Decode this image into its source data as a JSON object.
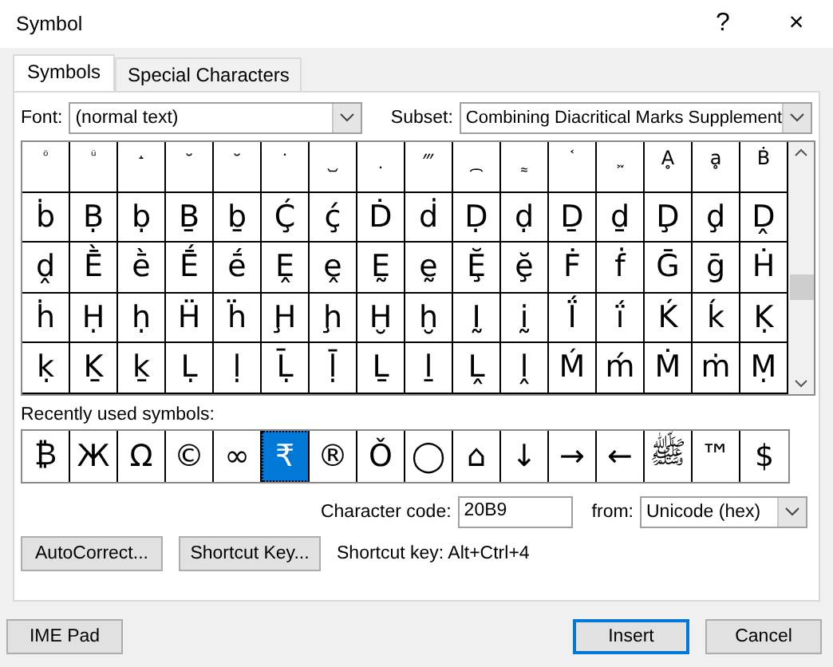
{
  "window": {
    "title": "Symbol",
    "help": "?",
    "close": "×"
  },
  "tabs": [
    {
      "label": "Symbols",
      "selected": true
    },
    {
      "label": "Special Characters",
      "selected": false
    }
  ],
  "font": {
    "label": "Font:",
    "value": "(normal text)"
  },
  "subset": {
    "label": "Subset:",
    "value": "Combining Diacritical Marks Supplement"
  },
  "symbol_grid": [
    [
      "ᷳ",
      "ᷴ",
      "᷵",
      "᷶",
      "᷷",
      "᷸",
      "᷹",
      "᷺",
      "᷻",
      "᷼",
      "᷽",
      "᷾",
      "᷿",
      "Ḁ",
      "ḁ",
      "Ḃ"
    ],
    [
      "ḃ",
      "Ḅ",
      "ḅ",
      "Ḇ",
      "ḇ",
      "Ḉ",
      "ḉ",
      "Ḋ",
      "ḋ",
      "Ḍ",
      "ḍ",
      "Ḏ",
      "ḏ",
      "Ḑ",
      "ḑ",
      "Ḓ"
    ],
    [
      "ḓ",
      "Ḕ",
      "ḕ",
      "Ḗ",
      "ḗ",
      "Ḙ",
      "ḙ",
      "Ḛ",
      "ḛ",
      "Ḝ",
      "ḝ",
      "Ḟ",
      "ḟ",
      "Ḡ",
      "ḡ",
      "Ḣ"
    ],
    [
      "ḣ",
      "Ḥ",
      "ḥ",
      "Ḧ",
      "ḧ",
      "Ḩ",
      "ḩ",
      "Ḫ",
      "ḫ",
      "Ḭ",
      "ḭ",
      "Ḯ",
      "ḯ",
      "Ḱ",
      "ḱ",
      "Ḳ"
    ],
    [
      "ḳ",
      "Ḵ",
      "ḵ",
      "Ḷ",
      "ḷ",
      "Ḹ",
      "ḹ",
      "Ḻ",
      "ḻ",
      "Ḽ",
      "ḽ",
      "Ḿ",
      "ḿ",
      "Ṁ",
      "ṁ",
      "Ṃ"
    ]
  ],
  "recent": {
    "label": "Recently used symbols:",
    "symbols": [
      {
        "char": "₿",
        "selected": false
      },
      {
        "char": "Ж",
        "selected": false
      },
      {
        "char": "Ω",
        "selected": false
      },
      {
        "char": "©",
        "selected": false
      },
      {
        "char": "∞",
        "selected": false
      },
      {
        "char": "₹",
        "selected": true
      },
      {
        "char": "®",
        "selected": false
      },
      {
        "char": "Ǒ",
        "selected": false
      },
      {
        "char": "◯",
        "selected": false
      },
      {
        "char": "⌂",
        "selected": false
      },
      {
        "char": "↓",
        "selected": false
      },
      {
        "char": "→",
        "selected": false
      },
      {
        "char": "←",
        "selected": false
      },
      {
        "char": "ﷺ",
        "selected": false
      },
      {
        "char": "™",
        "selected": false
      },
      {
        "char": "$",
        "selected": false
      }
    ]
  },
  "character_code": {
    "label": "Character code:",
    "value": "20B9"
  },
  "from": {
    "label": "from:",
    "value": "Unicode (hex)"
  },
  "buttons": [
    "AutoCorrect...",
    "Shortcut Key..."
  ],
  "shortcut_key": "Shortcut key: Alt+Ctrl+4",
  "footer": [
    {
      "label": "IME Pad",
      "default": false
    },
    {
      "label": "Insert",
      "default": true
    },
    {
      "label": "Cancel",
      "default": false
    }
  ]
}
